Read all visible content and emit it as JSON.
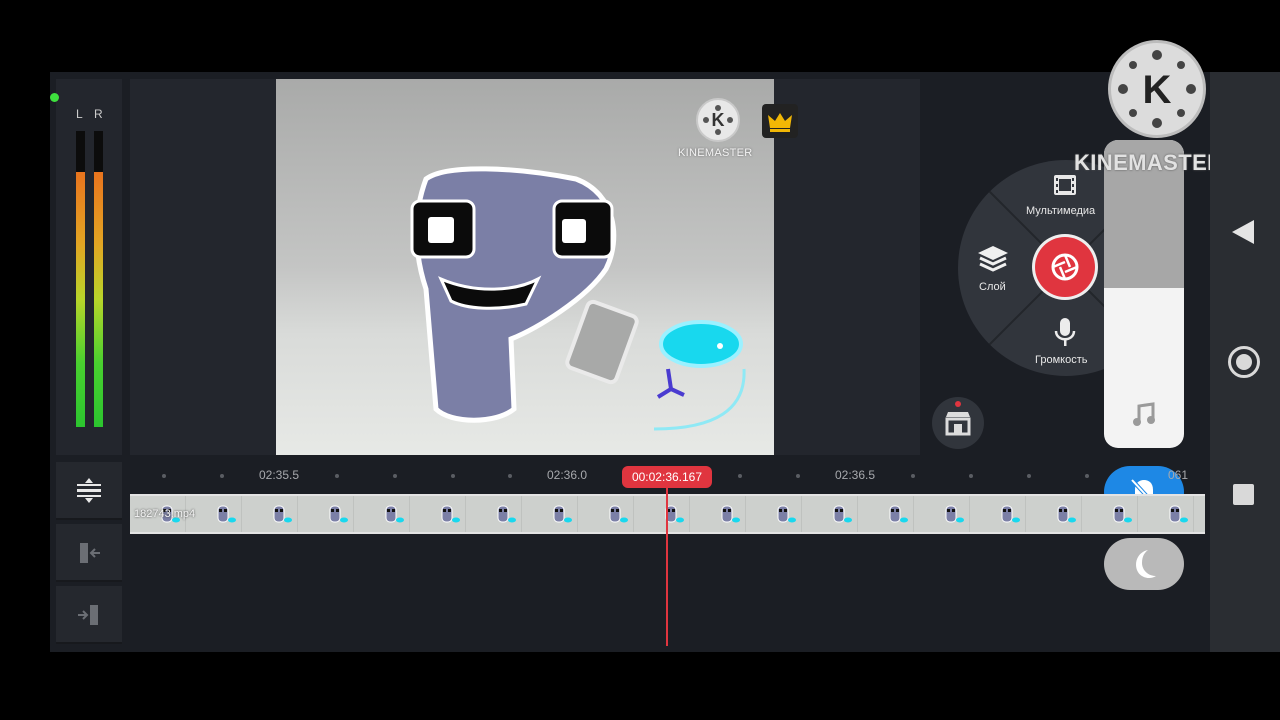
{
  "meter": {
    "left_label": "L",
    "right_label": "R",
    "left_level": 0.86,
    "right_level": 0.86
  },
  "watermark": {
    "text": "KINEMASTER",
    "logo_letter": "K"
  },
  "overlay": {
    "title": "KINEMASTER",
    "logo_letter": "K",
    "volume_level": 0.52
  },
  "radial_menu": {
    "media_label": "Мультимедиа",
    "layer_label": "Слой",
    "audio_label": "Громкость"
  },
  "timeline": {
    "ticks": [
      "02:35.5",
      "02:36.0",
      "02:36.5"
    ],
    "playhead_time": "00:02:36.167",
    "end_label": "061",
    "clip_name": "182743.mp4"
  },
  "colors": {
    "accent_red": "#e0353f",
    "accent_blue": "#1e88e5",
    "meter_green": "#2cc52f",
    "meter_orange": "#e9741e"
  },
  "icons": [
    "media-film-icon",
    "layers-icon",
    "record-camera-icon",
    "microphone-icon",
    "asset-store-icon",
    "music-note-icon",
    "mute-bell-icon",
    "moon-icon",
    "timeline-adjust-icon",
    "split-left-icon",
    "split-right-icon",
    "nav-back-icon",
    "nav-home-icon",
    "nav-recents-icon",
    "crown-icon"
  ]
}
